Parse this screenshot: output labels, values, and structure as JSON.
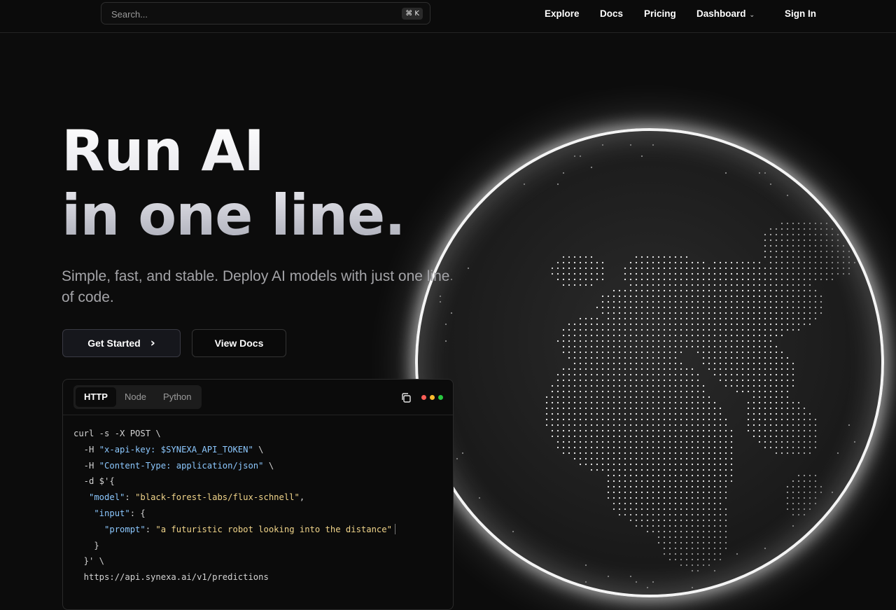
{
  "header": {
    "search": {
      "placeholder": "Search...",
      "shortcut": "⌘ K"
    },
    "nav": [
      {
        "label": "Explore"
      },
      {
        "label": "Docs"
      },
      {
        "label": "Pricing"
      },
      {
        "label": "Dashboard",
        "has_dropdown": true
      },
      {
        "label": "Sign In"
      }
    ]
  },
  "hero": {
    "title_line1": "Run AI",
    "title_line2": "in one line.",
    "subtitle": "Simple, fast, and stable. Deploy AI models with just one line of code.",
    "primary_button": "Get Started",
    "secondary_button": "View Docs"
  },
  "code_card": {
    "tabs": [
      "HTTP",
      "Node",
      "Python"
    ],
    "active_tab": "HTTP",
    "window_dot_colors": [
      "#ff5f57",
      "#febc2e",
      "#28c840"
    ],
    "lines": [
      {
        "parts": [
          {
            "t": "curl -s -X POST \\",
            "c": "plain"
          }
        ]
      },
      {
        "parts": [
          {
            "t": "  -H ",
            "c": "plain"
          },
          {
            "t": "\"x-api-key: $SYNEXA_API_TOKEN\"",
            "c": "key"
          },
          {
            "t": " \\",
            "c": "plain"
          }
        ]
      },
      {
        "parts": [
          {
            "t": "  -H ",
            "c": "plain"
          },
          {
            "t": "\"Content-Type: application/json\"",
            "c": "key"
          },
          {
            "t": " \\",
            "c": "plain"
          }
        ]
      },
      {
        "parts": [
          {
            "t": "  -d $'{",
            "c": "plain"
          }
        ]
      },
      {
        "parts": [
          {
            "t": "   \"model\"",
            "c": "key"
          },
          {
            "t": ": ",
            "c": "plain"
          },
          {
            "t": "\"black-forest-labs/flux-schnell\"",
            "c": "str"
          },
          {
            "t": ",",
            "c": "plain"
          }
        ]
      },
      {
        "parts": [
          {
            "t": "    \"input\"",
            "c": "key"
          },
          {
            "t": ": {",
            "c": "plain"
          }
        ]
      },
      {
        "parts": [
          {
            "t": "      \"prompt\"",
            "c": "key"
          },
          {
            "t": ": ",
            "c": "plain"
          },
          {
            "t": "\"a futuristic robot looking into the distance\"",
            "c": "str"
          }
        ],
        "caret": true
      },
      {
        "parts": [
          {
            "t": "    }",
            "c": "plain"
          }
        ]
      },
      {
        "parts": [
          {
            "t": "  }' \\",
            "c": "plain"
          }
        ]
      },
      {
        "parts": [
          {
            "t": "  https://api.synexa.ai/v1/predictions",
            "c": "plain"
          }
        ]
      }
    ]
  },
  "visual": {
    "globe_icon": "dotted-earth-globe",
    "accent": "#ffffff"
  }
}
